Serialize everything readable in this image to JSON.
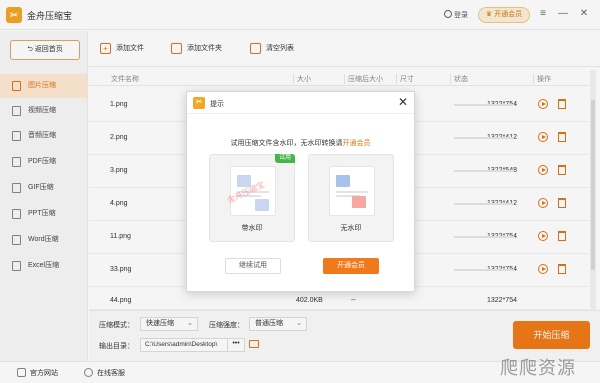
{
  "app": {
    "title": "金舟压缩宝",
    "logo_text": "✂"
  },
  "header": {
    "login_label": "登录",
    "vip_label": "开通会员",
    "win_menu": "≡",
    "win_min": "—",
    "win_close": "✕"
  },
  "sidebar": {
    "back_label": "返回首页",
    "items": [
      {
        "label": "图片压缩",
        "active": true
      },
      {
        "label": "视频压缩"
      },
      {
        "label": "音频压缩"
      },
      {
        "label": "PDF压缩"
      },
      {
        "label": "GIF压缩"
      },
      {
        "label": "PPT压缩"
      },
      {
        "label": "Word压缩"
      },
      {
        "label": "Excel压缩"
      }
    ]
  },
  "toolbar": {
    "add_file": "添加文件",
    "add_folder": "添加文件夹",
    "clear_list": "清空列表"
  },
  "table": {
    "headers": [
      "文件名称",
      "大小",
      "压缩后大小",
      "尺寸",
      "状态",
      "操作"
    ],
    "rows": [
      {
        "name": "1.png",
        "dims": "1322*754"
      },
      {
        "name": "2.png",
        "dims": "1322*412"
      },
      {
        "name": "3.png",
        "dims": "1322*548"
      },
      {
        "name": "4.png",
        "dims": "1322*412"
      },
      {
        "name": "11.png",
        "dims": "1322*754"
      },
      {
        "name": "33.png",
        "dims": "1322*754"
      },
      {
        "name": "44.png",
        "size": "402.0KB",
        "csize": "--",
        "dims": "1322*754"
      }
    ]
  },
  "settings": {
    "mode_label": "压缩模式：",
    "mode_value": "快速压缩",
    "strength_label": "压缩强度：",
    "strength_value": "普通压缩",
    "output_label": "输出目录：",
    "output_path": "C:\\Users\\admin\\Desktop\\",
    "browse_label": "•••",
    "start_label": "开始压缩"
  },
  "statusbar": {
    "website": "官方网站",
    "support": "在线客服",
    "watermark": "爬爬资源"
  },
  "modal": {
    "title": "提示",
    "close": "✕",
    "message_prefix": "试用压缩文件含水印，无水印转换请",
    "message_link": "开通会员",
    "card_watermark_label": "带水印",
    "card_watermark_text": "金舟压缩宝",
    "card_clean_label": "无水印",
    "trial_tag": "试用",
    "continue_label": "继续试用",
    "vip_label": "开通会员"
  },
  "colors": {
    "accent": "#f07a1a",
    "trial": "#44b549",
    "sidebar_active_bg": "#fde9d3"
  }
}
